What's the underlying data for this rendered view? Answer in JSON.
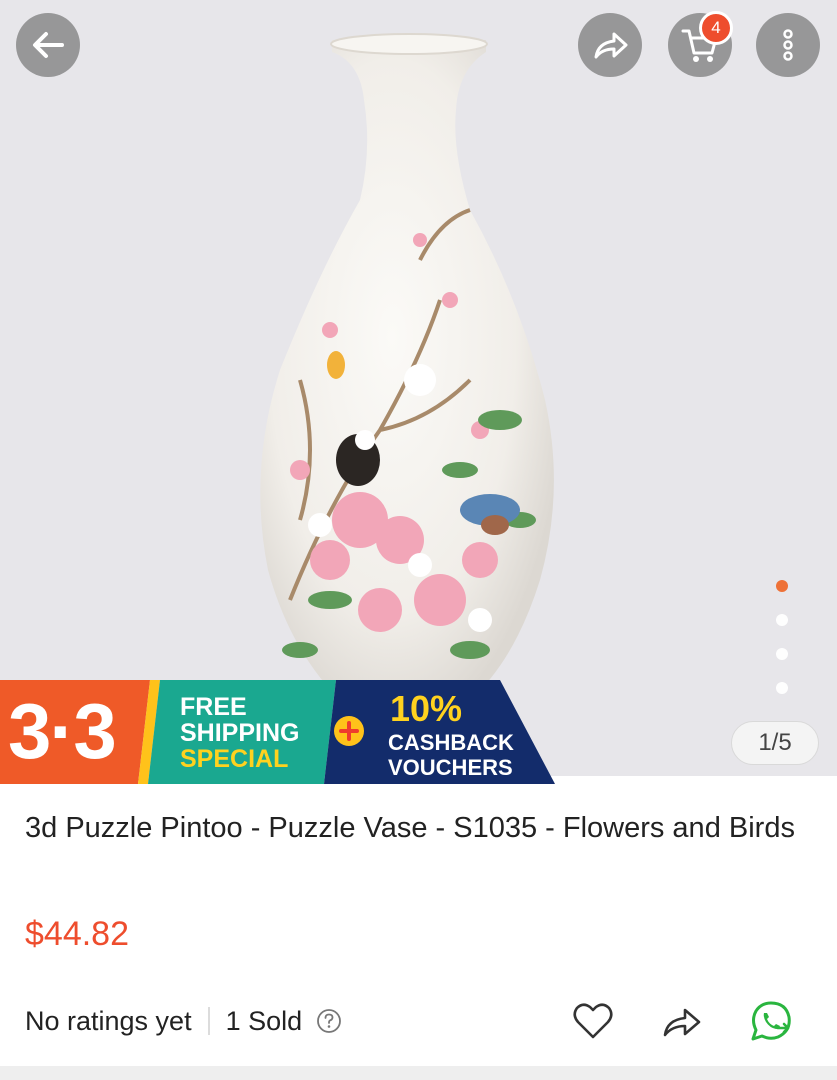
{
  "header": {
    "back_icon": "arrow-left-icon",
    "share_icon": "share-icon",
    "cart_icon": "shopping-cart-icon",
    "cart_count": "4",
    "more_icon": "more-vertical-icon"
  },
  "gallery": {
    "page_counter": "1/5",
    "dots_total": 5,
    "active_dot": 1
  },
  "banner": {
    "campaign": "3·3",
    "free_line1": "FREE",
    "free_line2": "SHIPPING",
    "free_line3": "SPECIAL",
    "percent": "10%",
    "cash_line1": "CASHBACK",
    "cash_line2": "VOUCHERS"
  },
  "product": {
    "title": "3d Puzzle Pintoo - Puzzle Vase - S1035 - Flowers and Birds",
    "price": "$44.82",
    "ratings": "No ratings yet",
    "sold": "1 Sold"
  },
  "actions": {
    "like_icon": "heart-icon",
    "share_icon": "share-icon",
    "whatsapp_icon": "whatsapp-icon"
  },
  "colors": {
    "accent": "#ee4d2d",
    "banner_orange": "#ef5a28",
    "banner_teal": "#1aa890",
    "banner_navy": "#132c6b",
    "whatsapp_green": "#2ab53f"
  }
}
